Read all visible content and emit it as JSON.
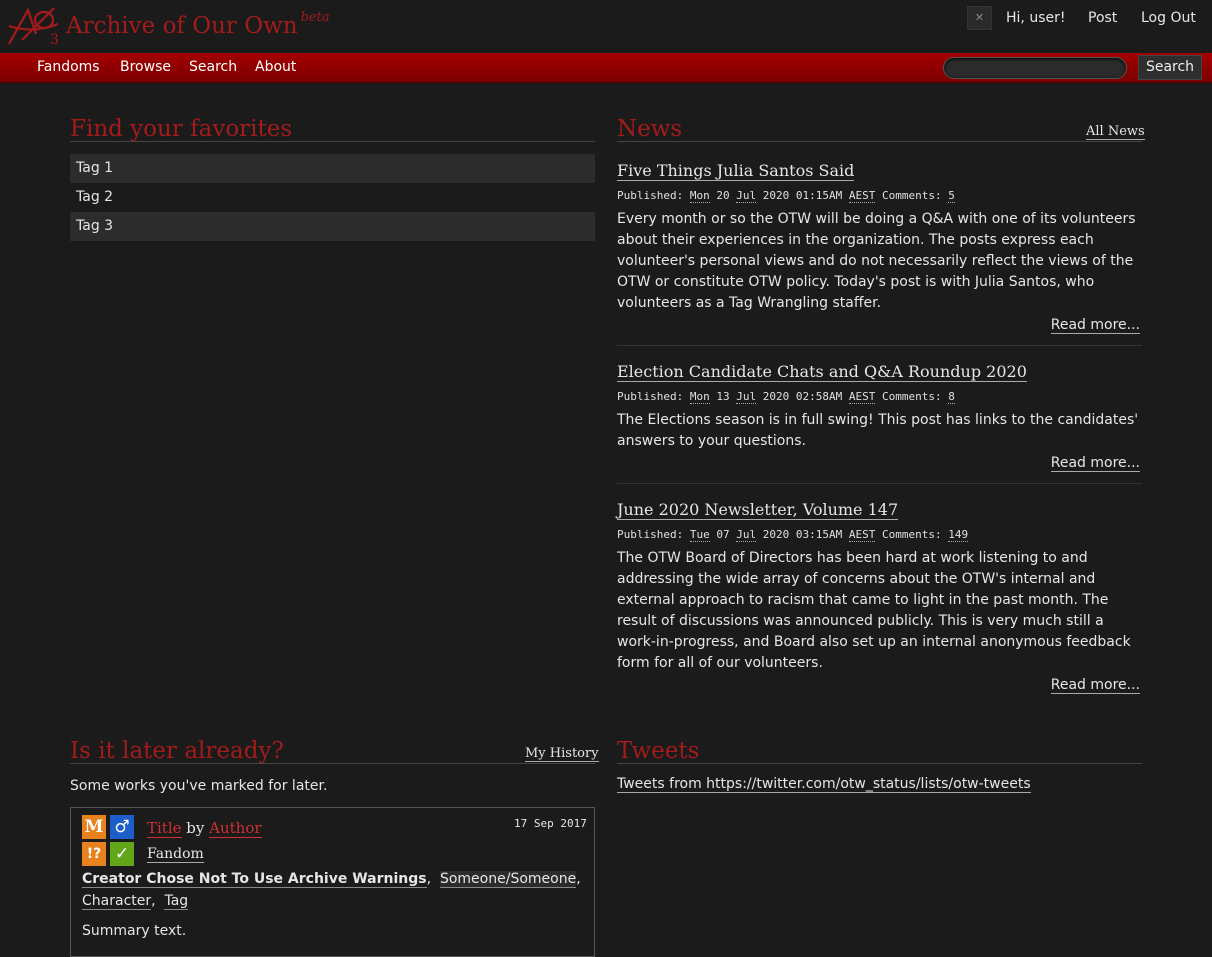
{
  "header": {
    "site_title": "Archive of Our Own",
    "site_beta": "beta",
    "greeting": "Hi, user!",
    "post": "Post",
    "logout": "Log Out"
  },
  "nav": {
    "fandoms": "Fandoms",
    "browse": "Browse",
    "search": "Search",
    "about": "About",
    "search_button": "Search"
  },
  "favorites": {
    "heading": "Find your favorites",
    "tags": [
      "Tag 1",
      "Tag 2",
      "Tag 3"
    ]
  },
  "news": {
    "heading": "News",
    "all_news": "All News",
    "published_label": "Published:",
    "comments_label": "Comments:",
    "read_more": "Read more...",
    "items": [
      {
        "title": "Five Things Julia Santos Said",
        "day": "Mon",
        "date": "20",
        "month": "Jul",
        "year": "2020",
        "time": "01:15AM",
        "tz": "AEST",
        "comments": "5",
        "body": "Every month or so the OTW will be doing a Q&A with one of its volunteers about their experiences in the organization. The posts express each volunteer's personal views and do not necessarily reflect the views of the OTW or constitute OTW policy. Today's post is with Julia Santos, who volunteers as a Tag Wrangling staffer."
      },
      {
        "title": "Election Candidate Chats and Q&A Roundup 2020",
        "day": "Mon",
        "date": "13",
        "month": "Jul",
        "year": "2020",
        "time": "02:58AM",
        "tz": "AEST",
        "comments": "8",
        "body": "The Elections season is in full swing! This post has links to the candidates' answers to your questions."
      },
      {
        "title": "June 2020 Newsletter, Volume 147",
        "day": "Tue",
        "date": "07",
        "month": "Jul",
        "year": "2020",
        "time": "03:15AM",
        "tz": "AEST",
        "comments": "149",
        "body": "The OTW Board of Directors has been hard at work listening to and addressing the wide array of concerns about the OTW's internal and external approach to racism that came to light in the past month. The result of discussions was announced publicly. This is very much still a work-in-progress, and Board also set up an internal anonymous feedback form for all of our volunteers."
      }
    ]
  },
  "later": {
    "heading": "Is it later already?",
    "history_link": "My History",
    "intro": "Some works you've marked for later.",
    "work": {
      "rating_icon": "M",
      "category_icon": "♂",
      "warning_icon": "!?",
      "complete_icon": "✓",
      "title": "Title",
      "by": "by",
      "author": "Author",
      "fandom": "Fandom",
      "date": "17 Sep 2017",
      "warning_tag": "Creator Chose Not To Use Archive Warnings",
      "relationship_tag": "Someone/Someone",
      "character_tag": "Character",
      "freeform_tag": "Tag",
      "summary": "Summary text.",
      "colors": {
        "rating": "#e8811e",
        "category": "#1e5ec8",
        "warning": "#e8811e",
        "complete": "#62a71a"
      }
    }
  },
  "tweets": {
    "heading": "Tweets",
    "link_text": "Tweets from https://twitter.com/otw_status/lists/otw-tweets"
  }
}
